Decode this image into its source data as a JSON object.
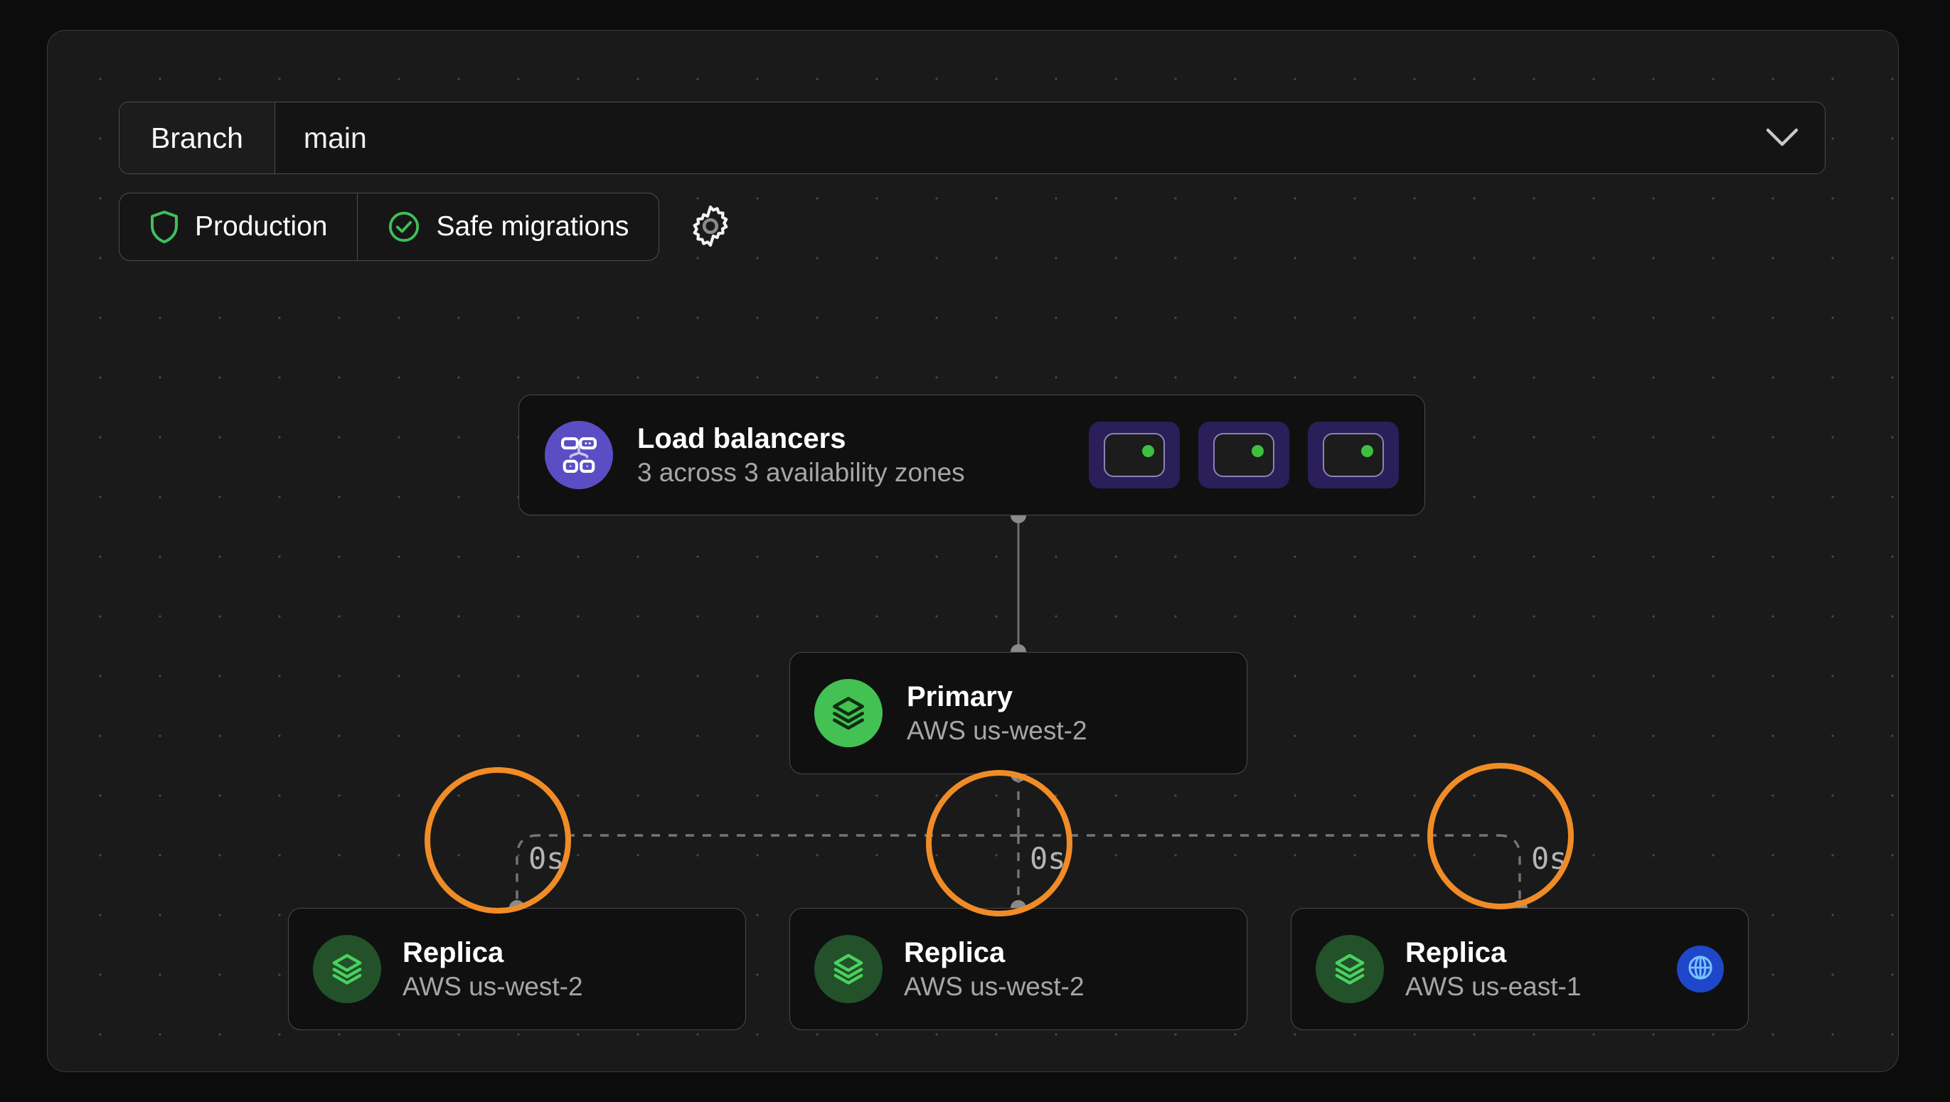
{
  "branch_selector": {
    "label": "Branch",
    "value": "main",
    "chevron_icon": "chevron-down-icon"
  },
  "toggles": {
    "production": {
      "label": "Production",
      "icon": "shield-icon",
      "icon_color": "#3fbf5a"
    },
    "safe_migrations": {
      "label": "Safe migrations",
      "icon": "check-circle-icon",
      "icon_color": "#3fbf5a"
    },
    "settings": {
      "icon": "gear-icon"
    }
  },
  "diagram": {
    "load_balancers": {
      "title": "Load balancers",
      "subtitle": "3 across 3 availability zones",
      "icon": "load-balancer-icon",
      "icon_bg": "#5b4ec4",
      "badges": [
        {
          "status": "healthy",
          "status_color": "#3fbf3f"
        },
        {
          "status": "healthy",
          "status_color": "#3fbf3f"
        },
        {
          "status": "healthy",
          "status_color": "#3fbf3f"
        }
      ]
    },
    "primary": {
      "title": "Primary",
      "subtitle": "AWS us-west-2",
      "icon": "layers-icon",
      "icon_bg": "#43c152"
    },
    "replicas": [
      {
        "title": "Replica",
        "subtitle": "AWS us-west-2",
        "icon": "layers-icon",
        "icon_bg": "#22512a",
        "latency": "0s",
        "globe": false
      },
      {
        "title": "Replica",
        "subtitle": "AWS us-west-2",
        "icon": "layers-icon",
        "icon_bg": "#22512a",
        "latency": "0s",
        "globe": false
      },
      {
        "title": "Replica",
        "subtitle": "AWS us-east-1",
        "icon": "layers-icon",
        "icon_bg": "#22512a",
        "latency": "0s",
        "globe": true,
        "globe_icon": "globe-icon",
        "globe_bg": "#1f47c9"
      }
    ]
  },
  "annotations": {
    "highlight_color": "#f08c28",
    "highlight_count": 3
  },
  "colors": {
    "page_bg": "#0c0c0c",
    "canvas_bg": "#1a1a1a",
    "card_bg": "#101010",
    "border": "#4a4a4a",
    "accent_green": "#3fbf5a",
    "accent_purple": "#5b4ec4",
    "accent_orange": "#f08c28",
    "accent_blue": "#1f47c9",
    "text_primary": "#ffffff",
    "text_muted": "#a6a6a6"
  }
}
